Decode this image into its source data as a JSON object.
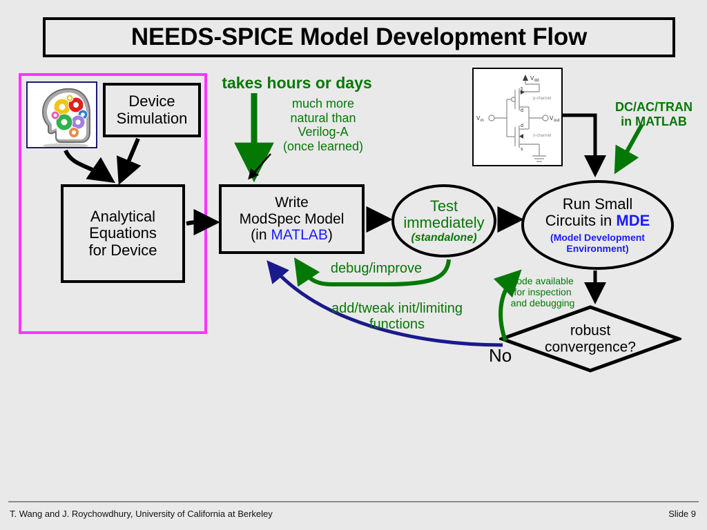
{
  "slide": {
    "title": "NEEDS-SPICE Model Development Flow",
    "background_color": "#e9e9e9"
  },
  "colors": {
    "green": "#047804",
    "blue": "#1a1aff",
    "navy_arrow": "#1a1a8c",
    "magenta": "#ff33ff",
    "black": "#000000"
  },
  "nodes": {
    "brain_image": "brain-gears-image",
    "device_simulation": {
      "line1": "Device",
      "line2": "Simulation"
    },
    "analytical_equations": {
      "line1": "Analytical",
      "line2": "Equations",
      "line3": "for Device"
    },
    "write_modspec": {
      "line1": "Write",
      "line2": "ModSpec Model",
      "line3_prefix": "(in ",
      "line3_highlight": "MATLAB",
      "line3_suffix": ")"
    },
    "test_immediately": {
      "line1": "Test",
      "line2": "immediately",
      "sub": "(standalone)"
    },
    "run_small_circuits": {
      "line1": "Run Small",
      "line2_prefix": "Circuits in ",
      "line2_highlight": "MDE",
      "sub_line1": "(Model Development",
      "sub_line2": "Environment)"
    },
    "decision": {
      "line1": "robust",
      "line2": "convergence?"
    }
  },
  "annotations": {
    "takes_hours": "takes hours or days",
    "much_more_natural": "much more\nnatural than\nVerilog-A\n(once learned)",
    "dc_ac_tran": "DC/AC/TRAN\nin MATLAB",
    "debug_improve": "debug/improve",
    "add_tweak": "add/tweak init/limiting\nfunctions",
    "code_available": "code available\nfor inspection\nand debugging",
    "no_label": "No"
  },
  "circuit_thumbnail": {
    "name": "cmos-inverter-schematic",
    "labels": {
      "vdd": "Vdd",
      "vin": "Vin",
      "vout": "Vout",
      "p_channel": "p-channel",
      "n_channel": "n-channel",
      "gate_top_s": "s",
      "gate_top_d": "d",
      "gate_bot_d": "d",
      "gate_bot_s": "s"
    }
  },
  "footer": {
    "left": "T. Wang and J. Roychowdhury, University of California at Berkeley",
    "right": "Slide 9"
  }
}
